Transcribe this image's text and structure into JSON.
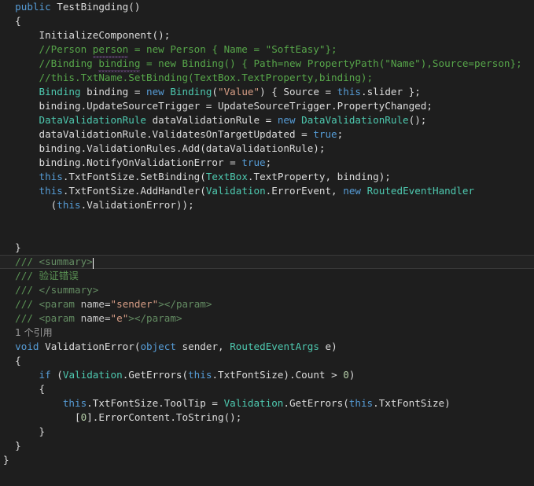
{
  "editor": {
    "background_color": "#1e1e1e",
    "current_line_color": "#232323",
    "colors": {
      "keyword": "#569cd6",
      "type": "#4ec9b0",
      "string": "#d69d85",
      "comment": "#57a64a",
      "doc_comment": "#5b9455",
      "doc_tag": "#638b62",
      "plain_text": "#dcdcdc",
      "codelens": "#9a9a9a",
      "squiggle": "#a36ac7"
    },
    "codelens_reference_label": "1 个引用",
    "lines": [
      {
        "n": 1,
        "indent": 2,
        "text": "public TestBingding()"
      },
      {
        "n": 2,
        "indent": 2,
        "text": "{"
      },
      {
        "n": 3,
        "indent": 6,
        "text": "InitializeComponent();"
      },
      {
        "n": 4,
        "indent": 6,
        "text": "//Person person = new Person { Name = \"SoftEasy\"};"
      },
      {
        "n": 5,
        "indent": 6,
        "text": "//Binding binding = new Binding() { Path=new PropertyPath(\"Name\"),Source=person};"
      },
      {
        "n": 6,
        "indent": 6,
        "text": "//this.TxtName.SetBinding(TextBox.TextProperty,binding);"
      },
      {
        "n": 7,
        "indent": 6,
        "text": "Binding binding = new Binding(\"Value\") { Source = this.slider };"
      },
      {
        "n": 8,
        "indent": 6,
        "text": "binding.UpdateSourceTrigger = UpdateSourceTrigger.PropertyChanged;"
      },
      {
        "n": 9,
        "indent": 6,
        "text": "DataValidationRule dataValidationRule = new DataValidationRule();"
      },
      {
        "n": 10,
        "indent": 6,
        "text": "dataValidationRule.ValidatesOnTargetUpdated = true;"
      },
      {
        "n": 11,
        "indent": 6,
        "text": "binding.ValidationRules.Add(dataValidationRule);"
      },
      {
        "n": 12,
        "indent": 6,
        "text": "binding.NotifyOnValidationError = true;"
      },
      {
        "n": 13,
        "indent": 6,
        "text": "this.TxtFontSize.SetBinding(TextBox.TextProperty, binding);"
      },
      {
        "n": 14,
        "indent": 6,
        "text": "this.TxtFontSize.AddHandler(Validation.ErrorEvent, new RoutedEventHandler"
      },
      {
        "n": 15,
        "indent": 8,
        "text": "(this.ValidationError));"
      },
      {
        "n": 16,
        "indent": 0,
        "text": ""
      },
      {
        "n": 17,
        "indent": 0,
        "text": ""
      },
      {
        "n": 18,
        "indent": 2,
        "text": "}"
      },
      {
        "n": 19,
        "indent": 2,
        "text": "/// <summary>",
        "current": true
      },
      {
        "n": 20,
        "indent": 2,
        "text": "/// 验证错误"
      },
      {
        "n": 21,
        "indent": 2,
        "text": "/// </summary>"
      },
      {
        "n": 22,
        "indent": 2,
        "text": "/// <param name=\"sender\"></param>"
      },
      {
        "n": 23,
        "indent": 2,
        "text": "/// <param name=\"e\"></param>"
      },
      {
        "n": 24,
        "indent": 2,
        "text": "1 个引用"
      },
      {
        "n": 25,
        "indent": 2,
        "text": "void ValidationError(object sender, RoutedEventArgs e)"
      },
      {
        "n": 26,
        "indent": 2,
        "text": "{"
      },
      {
        "n": 27,
        "indent": 6,
        "text": "if (Validation.GetErrors(this.TxtFontSize).Count > 0)"
      },
      {
        "n": 28,
        "indent": 6,
        "text": "{"
      },
      {
        "n": 29,
        "indent": 10,
        "text": "this.TxtFontSize.ToolTip = Validation.GetErrors(this.TxtFontSize)"
      },
      {
        "n": 30,
        "indent": 12,
        "text": "[0].ErrorContent.ToString();"
      },
      {
        "n": 31,
        "indent": 6,
        "text": "}"
      },
      {
        "n": 32,
        "indent": 2,
        "text": "}"
      },
      {
        "n": 33,
        "indent": 0,
        "text": "}"
      }
    ]
  }
}
